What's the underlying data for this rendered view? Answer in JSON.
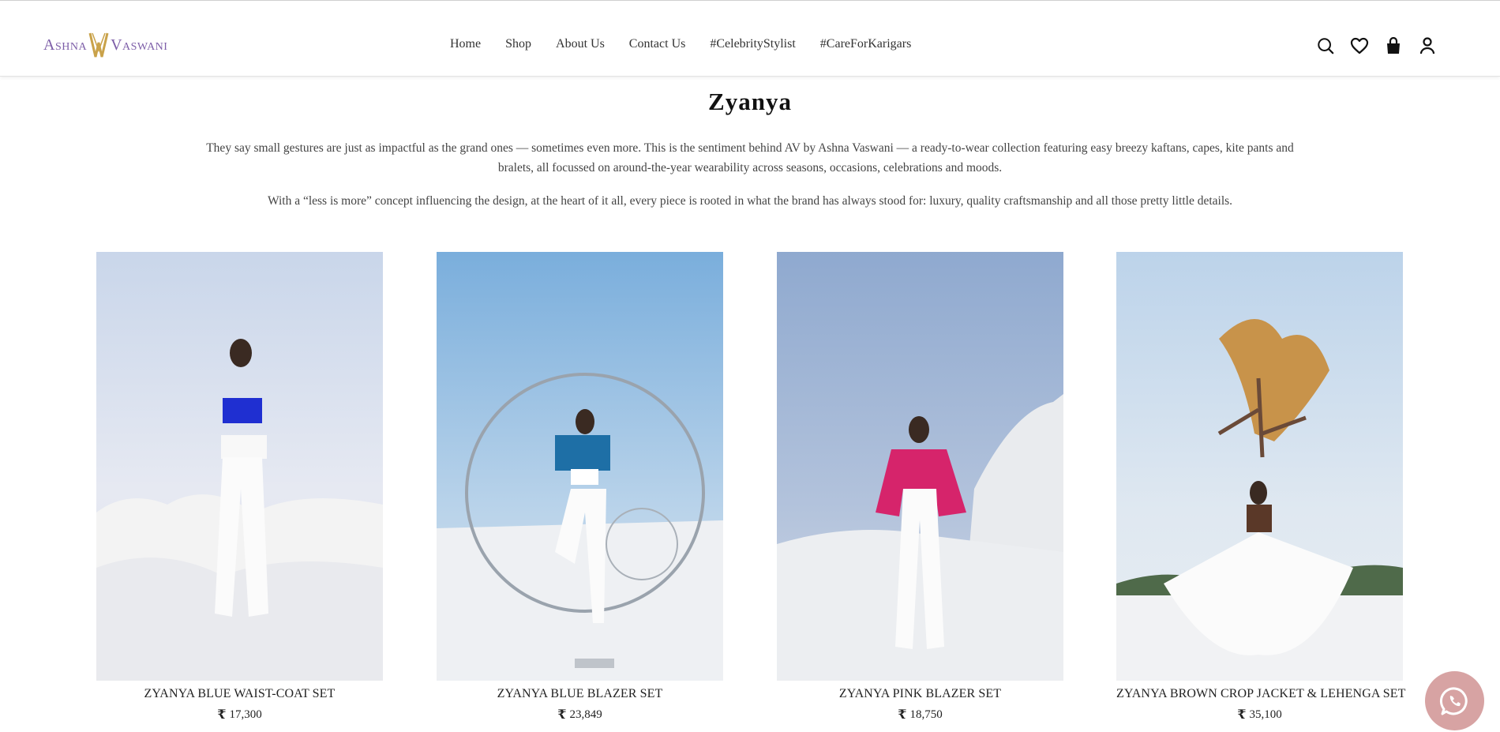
{
  "brand": {
    "logo_text_left": "Ashna",
    "logo_text_right": "Vaswani",
    "colors": {
      "logo_purple": "#7d5ea8",
      "logo_gold": "#c9a24a",
      "whatsapp_bg": "#d7a3a3"
    }
  },
  "nav": {
    "items": [
      {
        "label": "Home"
      },
      {
        "label": "Shop"
      },
      {
        "label": "About Us"
      },
      {
        "label": "Contact Us"
      },
      {
        "label": "#CelebrityStylist"
      },
      {
        "label": "#CareForKarigars"
      }
    ]
  },
  "header_icons": [
    "search-icon",
    "heart-icon",
    "bag-icon",
    "user-icon"
  ],
  "collection": {
    "title": "Zyanya",
    "paragraph_1": "They say small gestures are just as impactful as the grand ones — sometimes even more. This is the sentiment behind AV by Ashna Vaswani — a ready-to-wear collection featuring easy breezy kaftans, capes, kite pants and bralets, all focussed on around-the-year wearability across seasons, occasions, celebrations and moods.",
    "paragraph_2": "With a “less is more” concept influencing the design, at the heart of it all, every piece is rooted in what the brand has always stood for: luxury, quality craftsmanship and all those pretty little details."
  },
  "products": [
    {
      "name": "ZYANYA BLUE WAIST-COAT SET",
      "currency": "₹",
      "price": "17,300"
    },
    {
      "name": "ZYANYA BLUE BLAZER SET",
      "currency": "₹",
      "price": "23,849"
    },
    {
      "name": "ZYANYA PINK BLAZER SET",
      "currency": "₹",
      "price": "18,750"
    },
    {
      "name": "ZYANYA BROWN CROP JACKET & LEHENGA SET",
      "currency": "₹",
      "price": "35,100"
    }
  ]
}
